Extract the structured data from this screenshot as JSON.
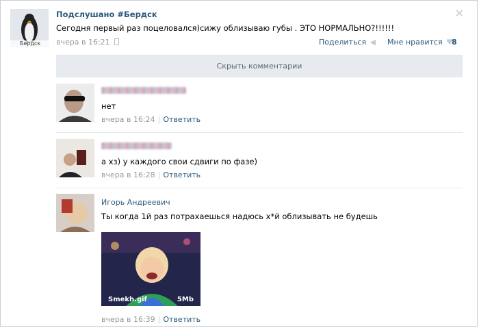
{
  "post": {
    "author": "Подслушано #Бердск",
    "avatar_caption": "Бердск",
    "text": "Сегодня первый раз поцеловался)сижу облизываю губы . ЭТО НОРМАЛЬНО?!!!!!!",
    "time": "вчера в 16:21",
    "share_label": "Поделиться",
    "like_label": "Мне нравится",
    "like_count": "8"
  },
  "hide_comments_label": "Скрыть комментарии",
  "comments": [
    {
      "text": "нет",
      "time": "вчера в 16:24",
      "reply_label": "Ответить"
    },
    {
      "text": "а хз) у каждого свои сдвиги по фазе)",
      "time": "вчера в 16:28",
      "reply_label": "Ответить"
    },
    {
      "author": "Игорь Андреевич",
      "text": "Ты когда 1й раз потрахаешься надюсь х*й облизывать не будешь",
      "time": "вчера в 16:39",
      "reply_label": "Ответить",
      "attachment": {
        "file_name": "Smekh.gif",
        "size": "5Mb"
      }
    }
  ],
  "colors": {
    "link": "#2b587a",
    "muted": "#999999",
    "bar_bg": "#e7eaee"
  }
}
